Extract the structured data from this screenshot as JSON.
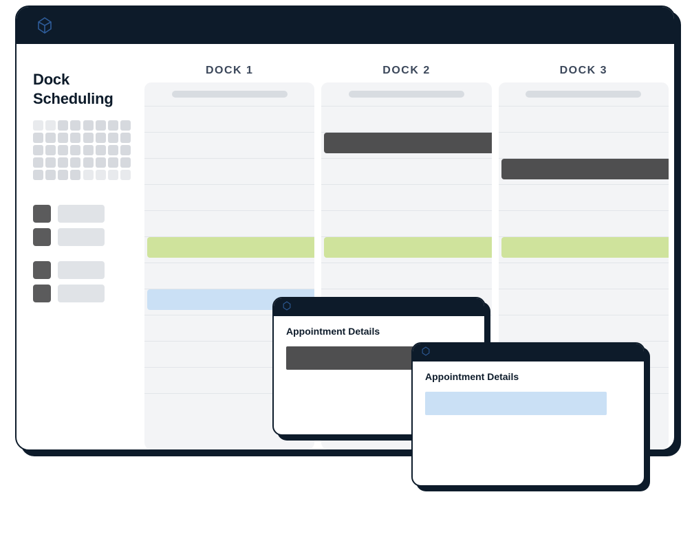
{
  "colors": {
    "navy": "#0d1b2a",
    "event_dark": "#4f4f50",
    "event_green": "#cfe39c",
    "event_blue": "#cae0f5"
  },
  "sidebar": {
    "title": "Dock Scheduling"
  },
  "docks": [
    {
      "label": "DOCK 1"
    },
    {
      "label": "DOCK 2"
    },
    {
      "label": "DOCK 3"
    }
  ],
  "popups": [
    {
      "title": "Appointment Details"
    },
    {
      "title": "Appointment Details"
    }
  ]
}
